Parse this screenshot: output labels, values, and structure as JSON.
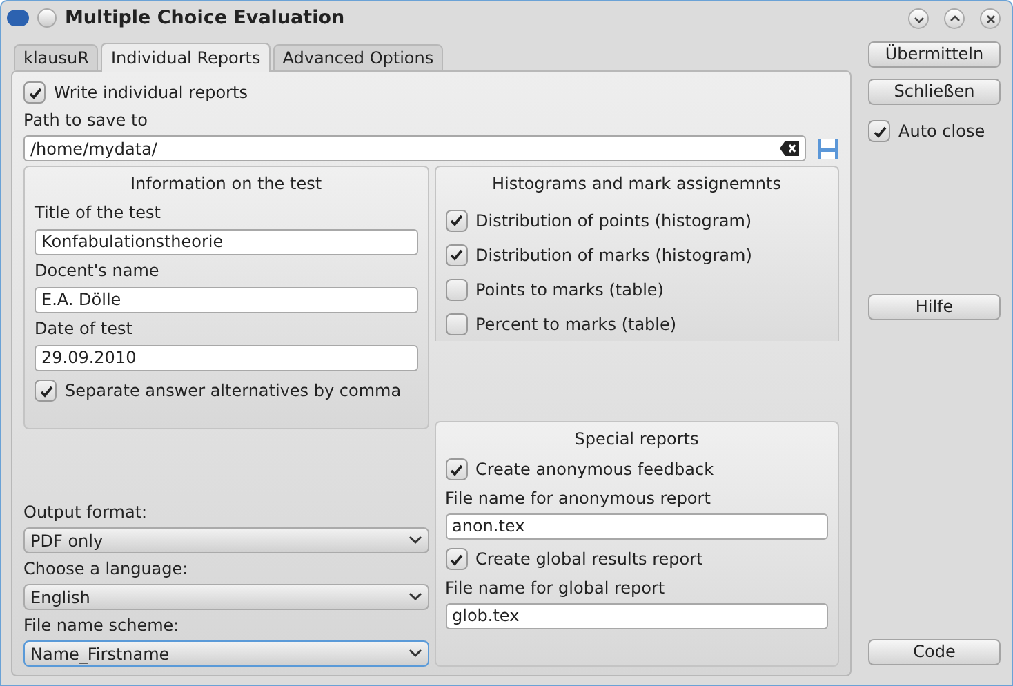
{
  "window": {
    "title": "Multiple Choice Evaluation"
  },
  "tabs": [
    {
      "label": "klausuR",
      "selected": false
    },
    {
      "label": "Individual Reports",
      "selected": true
    },
    {
      "label": "Advanced Options",
      "selected": false
    }
  ],
  "write_reports": {
    "label": "Write individual reports",
    "checked": true
  },
  "path": {
    "label": "Path to save to",
    "value": "/home/mydata/"
  },
  "info_group": {
    "title": "Information on the test",
    "fields": [
      {
        "label": "Title of the test",
        "value": "Konfabulationstheorie"
      },
      {
        "label": "Docent's name",
        "value": "E.A. Dölle"
      },
      {
        "label": "Date of test",
        "value": "29.09.2010"
      }
    ],
    "separate": {
      "label": "Separate answer alternatives by comma",
      "checked": true
    }
  },
  "histograms": {
    "title": "Histograms and mark assignemnts",
    "options": [
      {
        "label": "Distribution of points (histogram)",
        "checked": true
      },
      {
        "label": "Distribution of marks (histogram)",
        "checked": true
      },
      {
        "label": "Points to marks (table)",
        "checked": false
      },
      {
        "label": "Percent to marks (table)",
        "checked": false
      }
    ]
  },
  "special": {
    "title": "Special reports",
    "items": [
      {
        "kind": "checkbox",
        "label": "Create anonymous feedback",
        "checked": true
      },
      {
        "kind": "field",
        "label": "File name for anonymous report",
        "value": "anon.tex"
      },
      {
        "kind": "checkbox",
        "label": "Create global results report",
        "checked": true
      },
      {
        "kind": "field",
        "label": "File name for global report",
        "value": "glob.tex"
      }
    ]
  },
  "selects": [
    {
      "label": "Output format:",
      "value": "PDF only",
      "focused": false
    },
    {
      "label": "Choose a language:",
      "value": "English",
      "focused": false
    },
    {
      "label": "File name scheme:",
      "value": "Name_Firstname",
      "focused": true
    }
  ],
  "side": {
    "top_buttons": [
      "Übermitteln",
      "Schließen"
    ],
    "auto_close": {
      "label": "Auto close",
      "checked": true
    },
    "help": "Hilfe",
    "code": "Code"
  }
}
